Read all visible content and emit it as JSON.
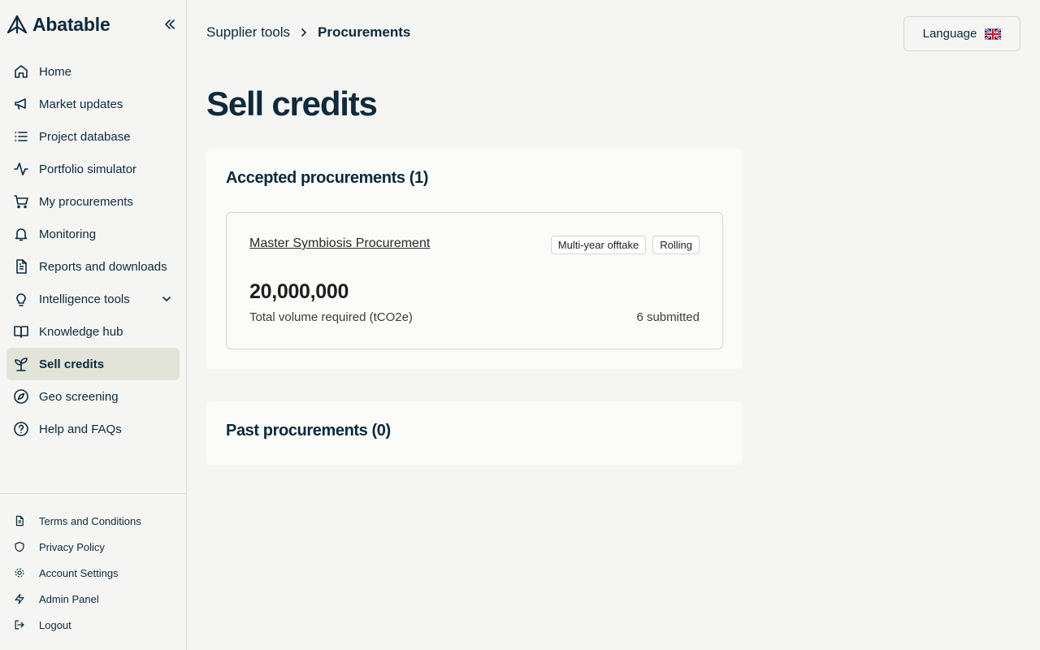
{
  "brand": {
    "name": "Abatable"
  },
  "sidebar": {
    "items": [
      {
        "label": "Home",
        "icon": "home-icon"
      },
      {
        "label": "Market updates",
        "icon": "megaphone-icon"
      },
      {
        "label": "Project database",
        "icon": "list-icon"
      },
      {
        "label": "Portfolio simulator",
        "icon": "activity-icon"
      },
      {
        "label": "My procurements",
        "icon": "cart-icon"
      },
      {
        "label": "Monitoring",
        "icon": "bell-icon"
      },
      {
        "label": "Reports and downloads",
        "icon": "document-icon"
      },
      {
        "label": "Intelligence tools",
        "icon": "lightbulb-icon"
      },
      {
        "label": "Knowledge hub",
        "icon": "book-icon"
      },
      {
        "label": "Sell credits",
        "icon": "sprout-icon",
        "active": true
      },
      {
        "label": "Geo screening",
        "icon": "compass-icon"
      },
      {
        "label": "Help and FAQs",
        "icon": "help-circle-icon"
      }
    ],
    "bottom": [
      {
        "label": "Terms and Conditions",
        "icon": "document-icon"
      },
      {
        "label": "Privacy Policy",
        "icon": "shield-icon"
      },
      {
        "label": "Account Settings",
        "icon": "gear-icon"
      },
      {
        "label": "Admin Panel",
        "icon": "lightning-icon"
      },
      {
        "label": "Logout",
        "icon": "logout-icon"
      }
    ]
  },
  "breadcrumb": {
    "parent": "Supplier tools",
    "current": "Procurements"
  },
  "language": {
    "label": "Language",
    "flag": "uk-flag-icon"
  },
  "page": {
    "title": "Sell credits"
  },
  "accepted": {
    "title": "Accepted procurements (1)",
    "procurement": {
      "name": "Master Symbiosis Procurement",
      "badges": [
        "Multi-year offtake",
        "Rolling"
      ],
      "volume": "20,000,000",
      "volume_label": "Total volume required (tCO2e)",
      "submitted": "6 submitted"
    }
  },
  "past": {
    "title": "Past procurements (0)"
  },
  "colors": {
    "text": "#0e2a3b",
    "background": "#f5f5f3",
    "card": "#fbfbfa",
    "active_nav": "#e2e4da",
    "border": "#d6d6d2"
  }
}
